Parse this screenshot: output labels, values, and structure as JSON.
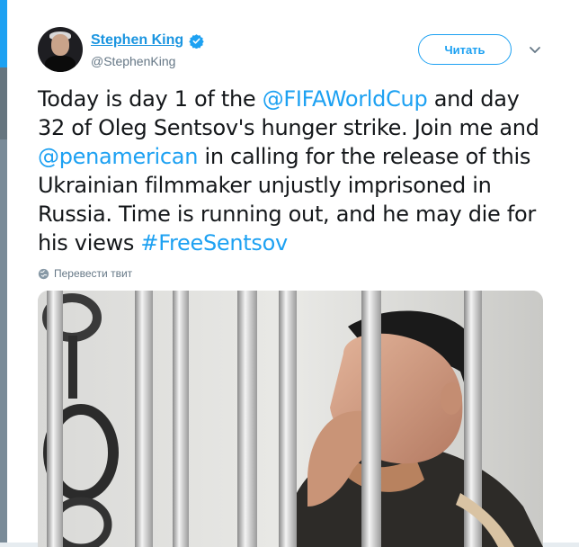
{
  "tweet": {
    "author": {
      "display_name": "Stephen King",
      "handle": "@StephenKing",
      "verified": true
    },
    "follow_button_label": "Читать",
    "text_parts": [
      {
        "text": "Today is day 1 of the ",
        "type": "text"
      },
      {
        "text": "@FIFAWorldCup",
        "type": "mention"
      },
      {
        "text": " and day 32 of Oleg Sentsov's hunger strike. Join me and ",
        "type": "text"
      },
      {
        "text": "@penamerican",
        "type": "mention"
      },
      {
        "text": " in calling for the release of this Ukrainian filmmaker unjustly imprisoned in Russia. Time is running out, and he may die for his views ",
        "type": "text"
      },
      {
        "text": "#FreeSentsov",
        "type": "hashtag"
      }
    ],
    "translate_label": "Перевести твит",
    "icons": {
      "verified": "verified-badge-icon",
      "more": "chevron-down-icon",
      "translate": "globe-icon"
    },
    "colors": {
      "accent": "#1da1f2",
      "name_link": "#1b95e0",
      "text": "#14171a",
      "secondary": "#657786"
    }
  }
}
